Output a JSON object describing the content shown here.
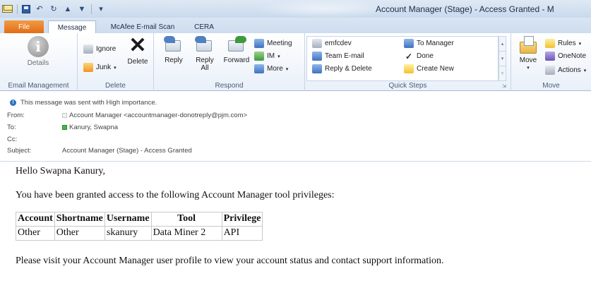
{
  "window": {
    "title": "Account Manager (Stage) - Access Granted - M"
  },
  "tabs": [
    {
      "label": "File"
    },
    {
      "label": "Message"
    },
    {
      "label": "McAfee E-mail Scan"
    },
    {
      "label": "CERA"
    }
  ],
  "ribbon": {
    "email_management": {
      "group_label": "Email Management",
      "details_label": "Details"
    },
    "delete_group": {
      "group_label": "Delete",
      "ignore_label": "Ignore",
      "junk_label": "Junk",
      "delete_label": "Delete"
    },
    "respond": {
      "group_label": "Respond",
      "reply_label": "Reply",
      "reply_all_label": "Reply All",
      "forward_label": "Forward",
      "meeting_label": "Meeting",
      "im_label": "IM",
      "more_label": "More"
    },
    "quick_steps": {
      "group_label": "Quick Steps",
      "items": [
        {
          "label": "emfcdev"
        },
        {
          "label": "Team E-mail"
        },
        {
          "label": "Reply & Delete"
        },
        {
          "label": "To Manager"
        },
        {
          "label": "Done"
        },
        {
          "label": "Create New"
        }
      ]
    },
    "move": {
      "group_label": "Move",
      "move_label": "Move",
      "rules_label": "Rules",
      "onenote_label": "OneNote",
      "actions_label": "Actions"
    }
  },
  "message_header": {
    "importance_notice": "This message was sent with High importance.",
    "from_label": "From:",
    "from_value": "Account Manager <accountmanager-donotreply@pjm.com>",
    "to_label": "To:",
    "to_value": "Kanury, Swapna",
    "cc_label": "Cc:",
    "cc_value": "",
    "subject_label": "Subject:",
    "subject_value": "Account Manager (Stage) - Access Granted"
  },
  "message_body": {
    "greeting": "Hello Swapna Kanury,",
    "intro": "You have been granted access to the following Account Manager tool privileges:",
    "table": {
      "headers": [
        "Account",
        "Shortname",
        "Username",
        "Tool",
        "Privilege"
      ],
      "rows": [
        [
          "Other",
          "Other",
          "skanury",
          "Data Miner 2",
          "API"
        ]
      ]
    },
    "closing": "Please visit your Account Manager user profile to view your account status and contact support information."
  }
}
